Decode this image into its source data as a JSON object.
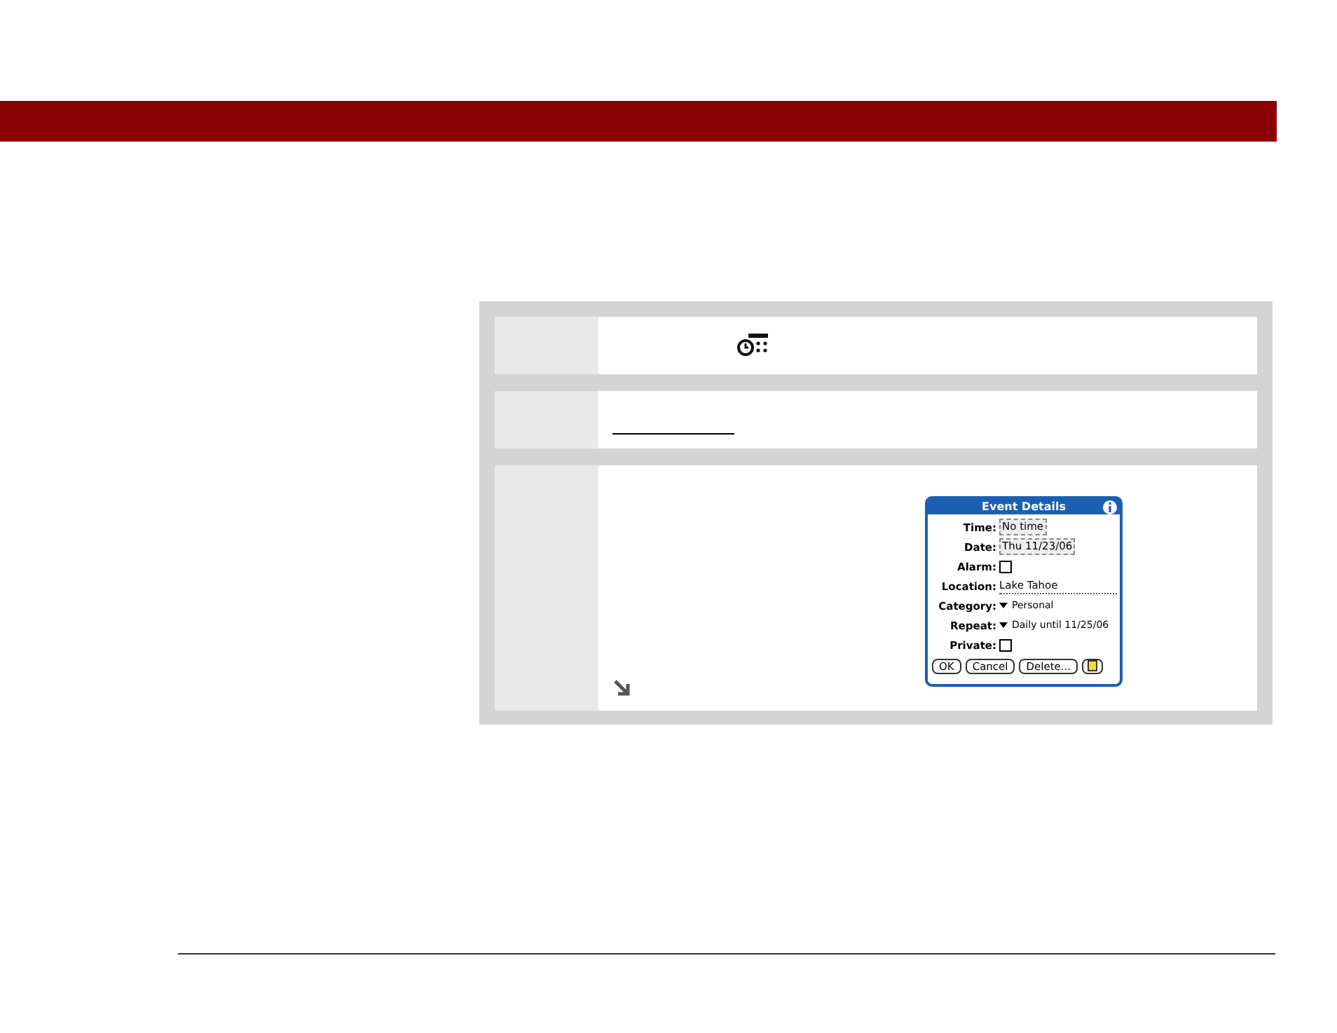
{
  "dialog": {
    "title": "Event Details",
    "fields": [
      {
        "label": "Time:",
        "kind": "button",
        "value": "No time"
      },
      {
        "label": "Date:",
        "kind": "button",
        "value": "Thu 11/23/06"
      },
      {
        "label": "Alarm:",
        "kind": "checkbox",
        "checked": false
      },
      {
        "label": "Location:",
        "kind": "text",
        "value": "Lake Tahoe"
      },
      {
        "label": "Category:",
        "kind": "dropdown",
        "value": "Personal"
      },
      {
        "label": "Repeat:",
        "kind": "dropdown",
        "value": "Daily until 11/25/06"
      },
      {
        "label": "Private:",
        "kind": "checkbox",
        "checked": false
      }
    ],
    "buttons": [
      "OK",
      "Cancel",
      "Delete..."
    ]
  }
}
